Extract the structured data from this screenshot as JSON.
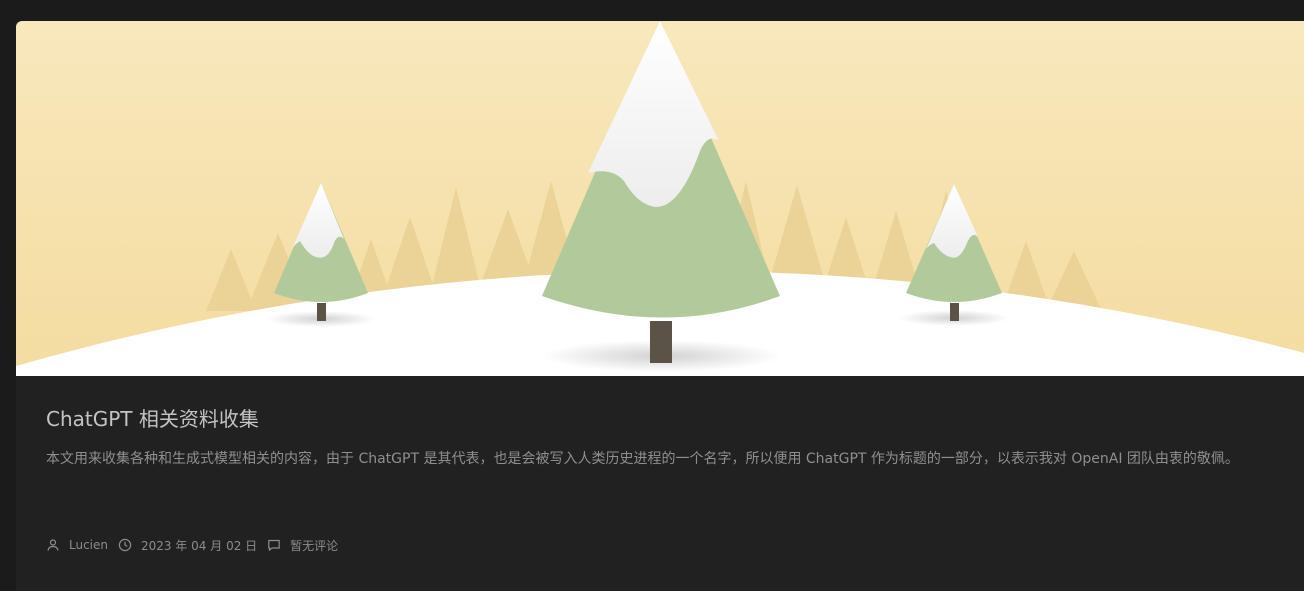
{
  "post": {
    "title": "ChatGPT 相关资料收集",
    "excerpt": "本文用来收集各种和生成式模型相关的内容，由于 ChatGPT 是其代表，也是会被写入人类历史进程的一个名字，所以便用 ChatGPT 作为标题的一部分，以表示我对 OpenAI 团队由衷的敬佩。",
    "author": "Lucien",
    "date": "2023 年 04 月 02 日",
    "comments": "暂无评论"
  },
  "icons": {
    "author": "user-icon",
    "date": "clock-icon",
    "comments": "comment-icon"
  },
  "colors": {
    "page_background": "#1b1b1b",
    "card_background": "#212121",
    "sky": "#f7e3ad",
    "tree_green": "#b2c99b",
    "snow": "#ffffff"
  }
}
